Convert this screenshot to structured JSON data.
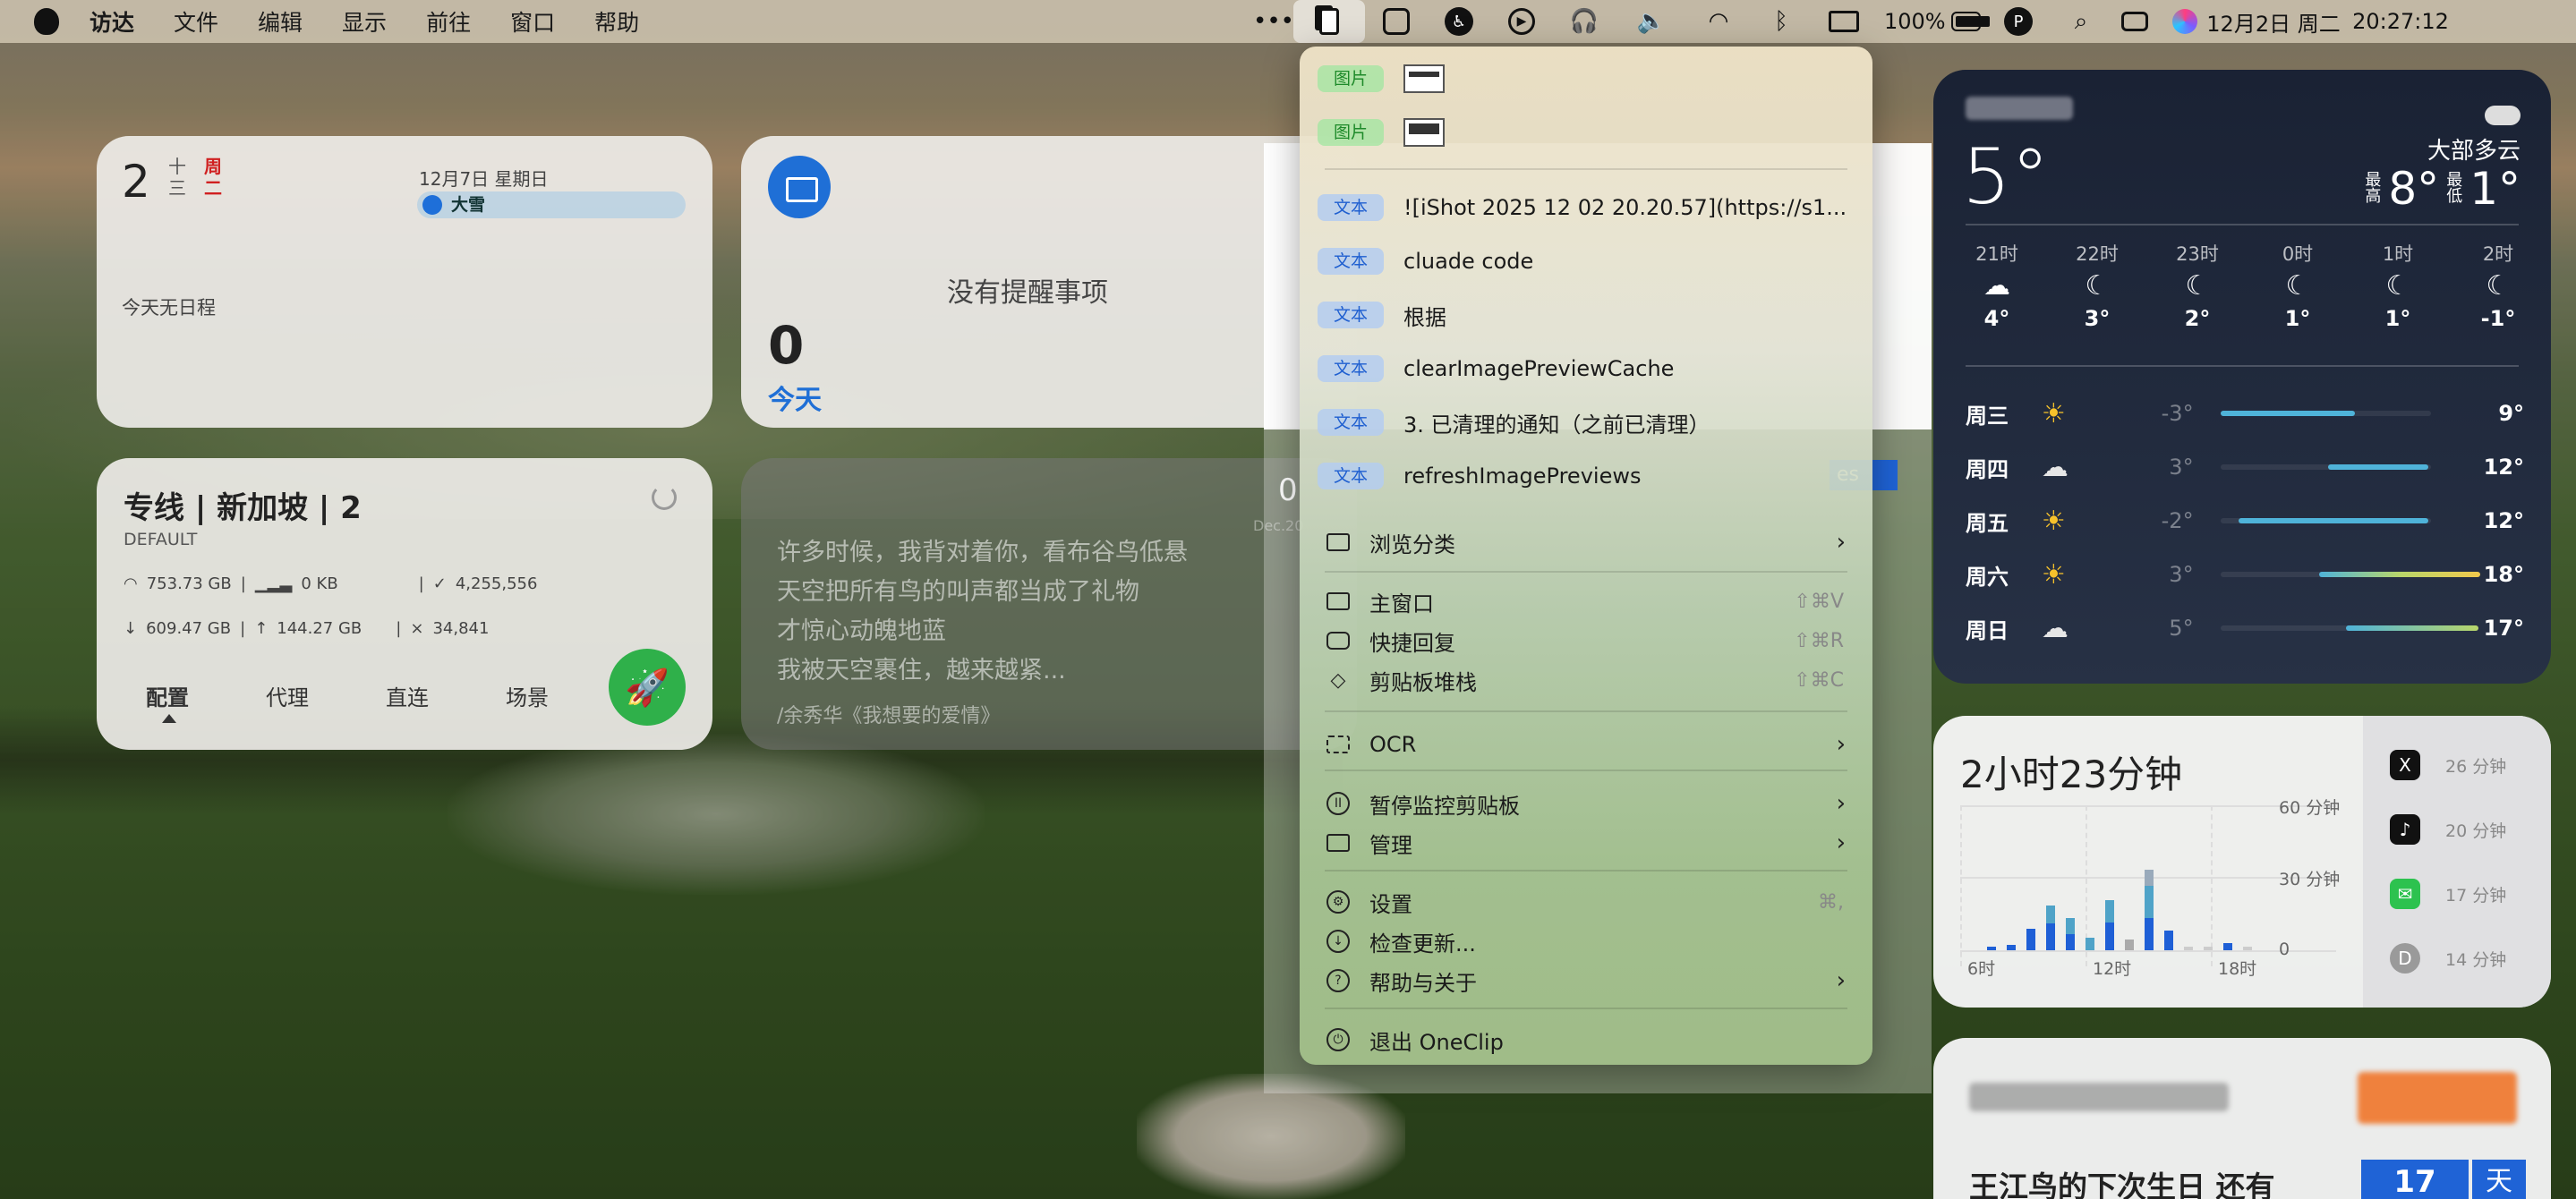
{
  "menubar": {
    "items": [
      "访达",
      "文件",
      "编辑",
      "显示",
      "前往",
      "窗口",
      "帮助"
    ],
    "battery": "100%",
    "date": "12月2日 周二",
    "time": "20:27:12"
  },
  "calendar": {
    "day": "2",
    "lunar": "十\n三",
    "weekday": "周\n二",
    "event_date": "12月7日 星期日",
    "event_name": "大雪",
    "no_schedule": "今天无日程"
  },
  "reminders": {
    "none": "没有提醒事项",
    "count": "0",
    "today": "今天"
  },
  "vpn": {
    "title": "专线 | 新加坡 | 2",
    "subtitle": "DEFAULT",
    "row1": [
      "753.73 GB",
      "0 KB",
      "4,255,556"
    ],
    "row2": [
      "609.47 GB",
      "144.27 GB",
      "34,841"
    ],
    "tabs": [
      "配置",
      "代理",
      "直连",
      "场景"
    ]
  },
  "quote": {
    "lines": [
      "许多时候，我背对着你，看布谷鸟低悬",
      "天空把所有鸟的叫声都当成了礼物",
      "才惊心动魄地蓝",
      "我被天空裹住，越来越紧..."
    ],
    "source": "/余秀华《我想要的爱情》"
  },
  "menu": {
    "items": [
      {
        "tag": "图片",
        "type": "image"
      },
      {
        "tag": "图片",
        "type": "image"
      },
      {
        "tag": "文本",
        "text": "![iShot 2025 12 02 20.20.57](https://s1..."
      },
      {
        "tag": "文本",
        "text": "cluade code"
      },
      {
        "tag": "文本",
        "text": "根据"
      },
      {
        "tag": "文本",
        "text": "clearImagePreviewCache"
      },
      {
        "tag": "文本",
        "text": "3. 已清理的通知（之前已清理）"
      },
      {
        "tag": "文本",
        "text": "refreshImagePreviews"
      }
    ],
    "browse": "浏览分类",
    "main_window": "主窗口",
    "main_window_sc": "⇧⌘V",
    "quick_reply": "快捷回复",
    "quick_reply_sc": "⇧⌘R",
    "stack": "剪贴板堆栈",
    "stack_sc": "⇧⌘C",
    "ocr": "OCR",
    "pause": "暂停监控剪贴板",
    "manage": "管理",
    "settings": "设置",
    "settings_sc": "⌘,",
    "check_update": "检查更新...",
    "help": "帮助与关于",
    "quit": "退出 OneClip"
  },
  "weather": {
    "temp": "5°",
    "condition": "大部多云",
    "hi_label": "最\n高",
    "hi": "8°",
    "lo_label": "最\n低",
    "lo": "1°",
    "hourly": [
      {
        "t": "21时",
        "i": "☁",
        "v": "4°"
      },
      {
        "t": "22时",
        "i": "☾",
        "v": "3°"
      },
      {
        "t": "23时",
        "i": "☾",
        "v": "2°"
      },
      {
        "t": "0时",
        "i": "☾",
        "v": "1°"
      },
      {
        "t": "1时",
        "i": "☾",
        "v": "1°"
      },
      {
        "t": "2时",
        "i": "☾",
        "v": "-1°"
      }
    ],
    "daily": [
      {
        "d": "周三",
        "i": "sun",
        "lo": "-3°",
        "hi": "9°"
      },
      {
        "d": "周四",
        "i": "cloud",
        "lo": "3°",
        "hi": "12°"
      },
      {
        "d": "周五",
        "i": "sun",
        "lo": "-2°",
        "hi": "12°"
      },
      {
        "d": "周六",
        "i": "sun",
        "lo": "3°",
        "hi": "18°"
      },
      {
        "d": "周日",
        "i": "cloud",
        "lo": "5°",
        "hi": "17°"
      }
    ]
  },
  "screentime": {
    "total": "2小时23分钟",
    "axis_y": [
      "60 分钟",
      "30 分钟",
      "0"
    ],
    "axis_x": [
      "6时",
      "12时",
      "18时"
    ],
    "apps": [
      {
        "name": "X",
        "time": "26 分钟"
      },
      {
        "name": "TikTok",
        "time": "20 分钟"
      },
      {
        "name": "WeChat",
        "time": "17 分钟"
      },
      {
        "name": "D",
        "time": "14 分钟"
      }
    ]
  },
  "birthday": {
    "text": "王江鸟的下次生日 还有",
    "days": "17",
    "unit": "天"
  },
  "misc": {
    "peek_zero": "0",
    "peek_dec": "Dec.20",
    "chip": "es"
  }
}
